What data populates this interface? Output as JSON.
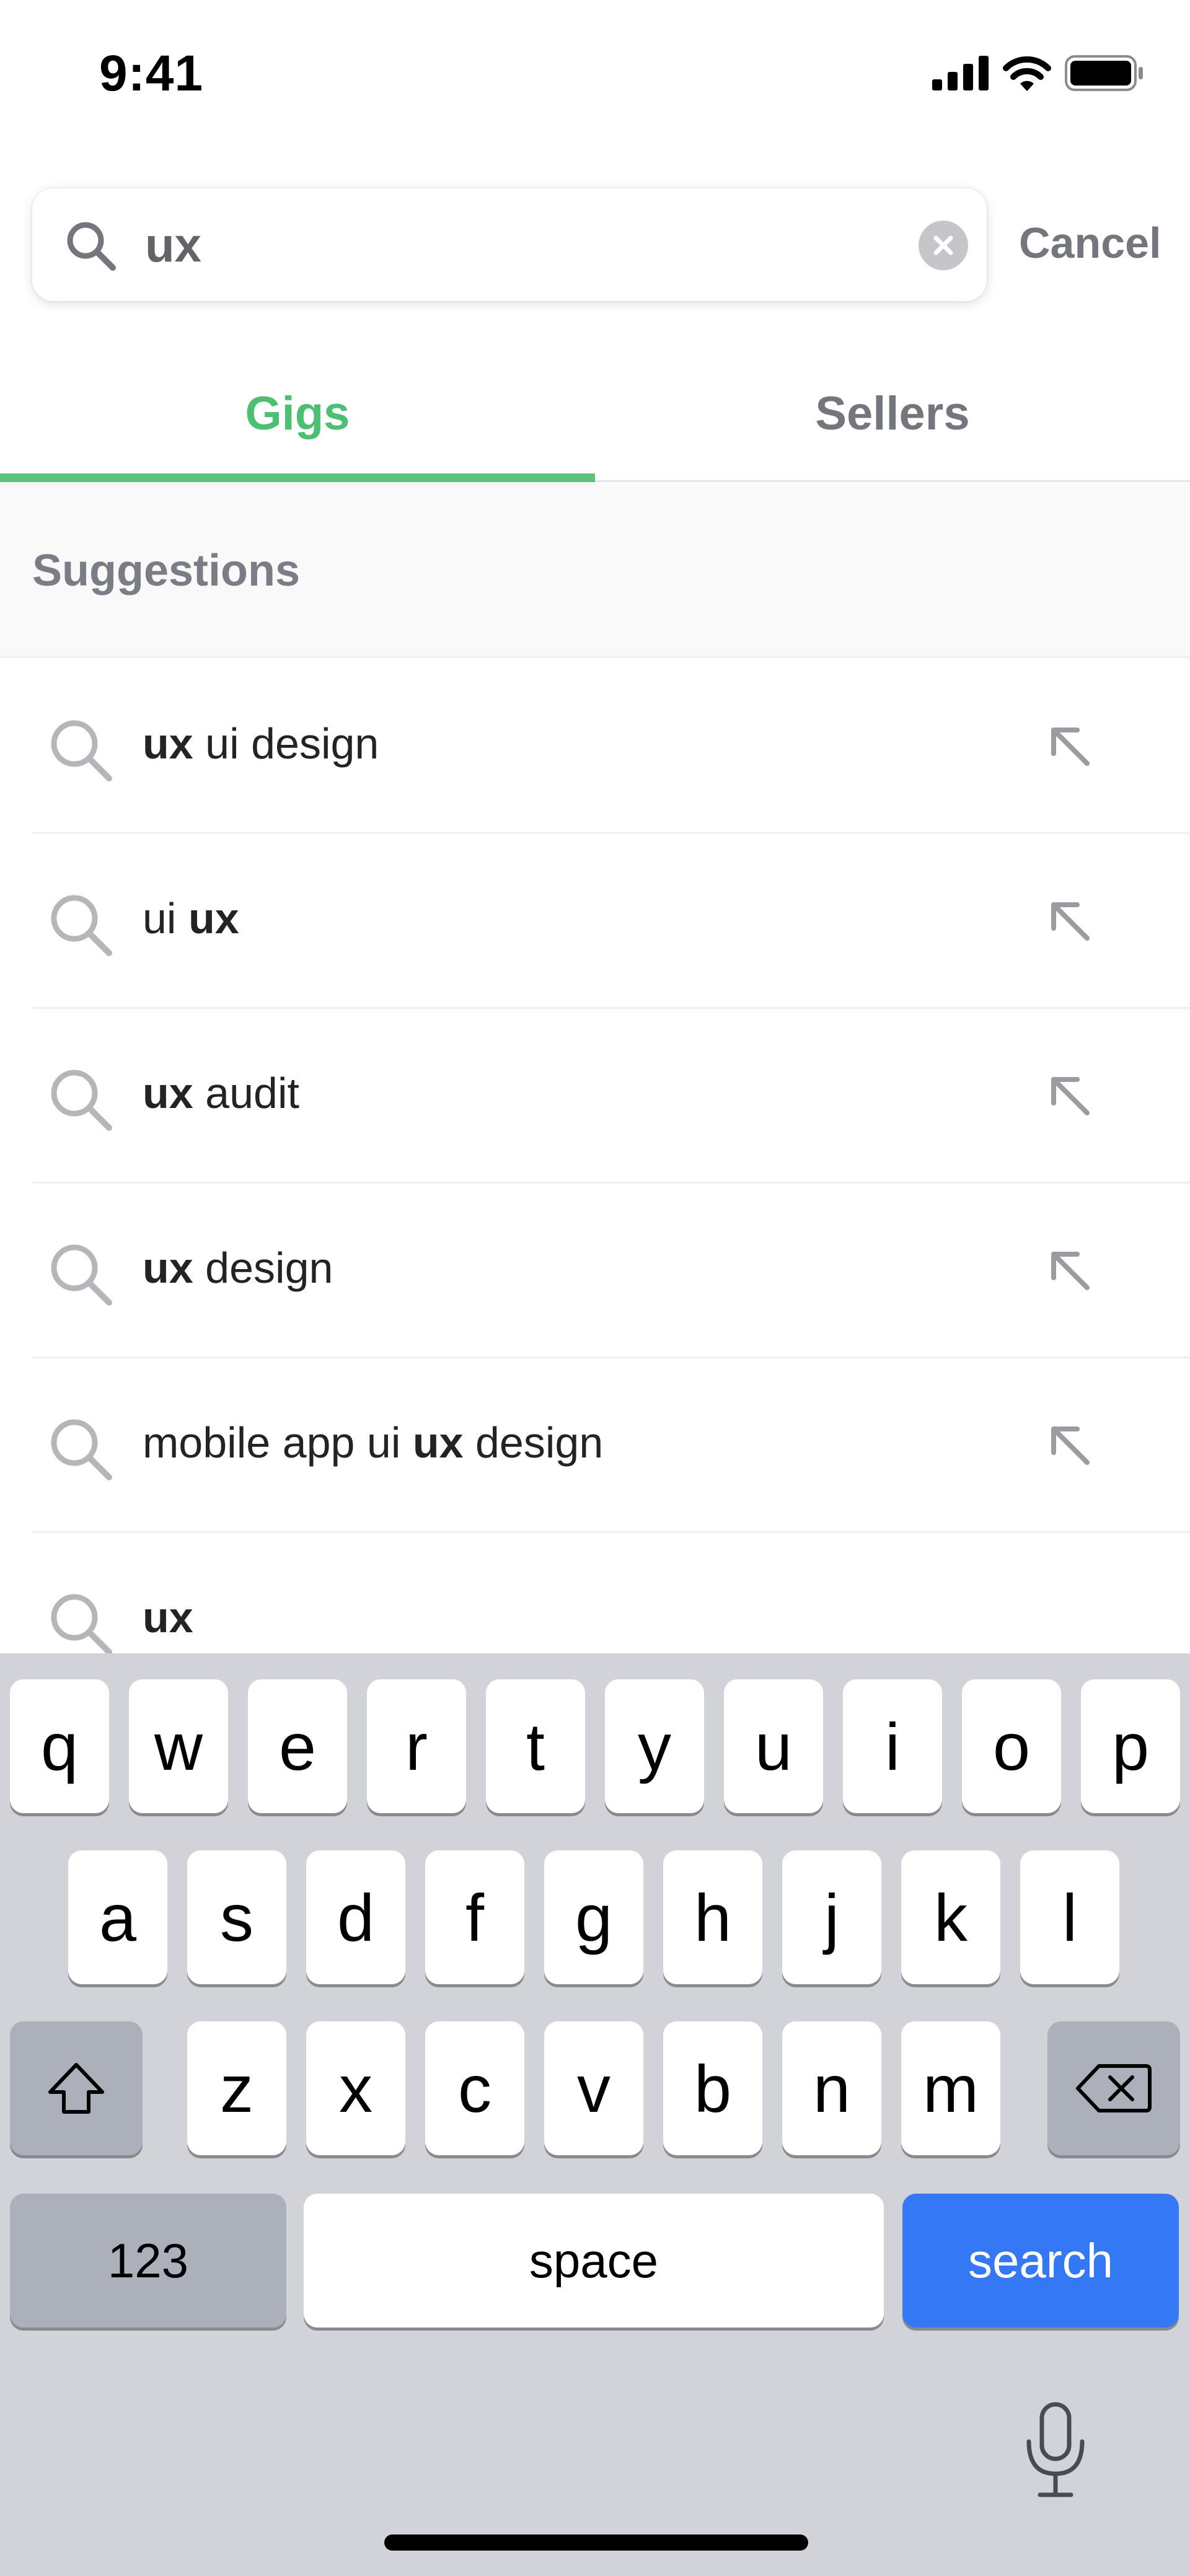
{
  "status_bar": {
    "time": "9:41",
    "icons": [
      "cellular-signal-icon",
      "wifi-icon",
      "battery-icon"
    ]
  },
  "search": {
    "value": "ux",
    "placeholder": "",
    "cancel_label": "Cancel"
  },
  "tabs": [
    {
      "label": "Gigs",
      "active": true
    },
    {
      "label": "Sellers",
      "active": false
    }
  ],
  "suggestions": {
    "title": "Suggestions",
    "items": [
      {
        "before": "",
        "match": "ux",
        "after": " ui design"
      },
      {
        "before": "ui ",
        "match": "ux",
        "after": ""
      },
      {
        "before": "",
        "match": "ux",
        "after": " audit"
      },
      {
        "before": "",
        "match": "ux",
        "after": " design"
      },
      {
        "before": "mobile app ui ",
        "match": "ux",
        "after": " design"
      },
      {
        "before": "",
        "match": "ux",
        "after": ""
      }
    ]
  },
  "keyboard": {
    "row1": [
      "q",
      "w",
      "e",
      "r",
      "t",
      "y",
      "u",
      "i",
      "o",
      "p"
    ],
    "row2": [
      "a",
      "s",
      "d",
      "f",
      "g",
      "h",
      "j",
      "k",
      "l"
    ],
    "row3": [
      "z",
      "x",
      "c",
      "v",
      "b",
      "n",
      "m"
    ],
    "numbers_label": "123",
    "space_label": "space",
    "search_label": "search",
    "shift_icon": "shift-icon",
    "delete_icon": "backspace-icon",
    "dictation_icon": "microphone-icon"
  },
  "colors": {
    "accent": "#4cbf70",
    "text_primary": "#222325",
    "text_secondary": "#74767e",
    "keyboard_bg": "#d1d3d9",
    "search_key": "#3478f6"
  }
}
